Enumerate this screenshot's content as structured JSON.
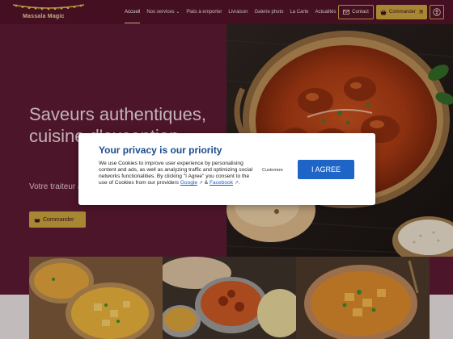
{
  "header": {
    "brand": "Massala Magic",
    "nav": [
      {
        "label": "Accueil",
        "active": true
      },
      {
        "label": "Nos services ⌄",
        "active": false
      },
      {
        "label": "Plats à emporter",
        "active": false
      },
      {
        "label": "Livraison",
        "active": false
      },
      {
        "label": "Galerie photo",
        "active": false
      },
      {
        "label": "La Carte",
        "active": false
      },
      {
        "label": "Actualités",
        "active": false
      }
    ],
    "contact_label": "Contact",
    "order_label": "Commander",
    "accessibility_icon": "accessibility-icon"
  },
  "hero": {
    "title": "Saveurs authentiques, cuisine d'exception",
    "subtitle": "Votre traiteur à Paris",
    "button_label": "Commander"
  },
  "cookie_banner": {
    "title": "Your privacy is our priority",
    "body": "We use Cookies to improve user experience by personalising content and ads, as well as analyzing traffic and optimizing social networks functionalities. By clicking \"I Agree\" you consent to the use of Cookies from our providers",
    "link_google": "Google",
    "link_and": "&",
    "link_facebook": "Facebook",
    "customize_label": "Customize",
    "agree_label": "I AGREE"
  },
  "colors": {
    "brand_bg": "#5a1930",
    "header_bg": "#4e1227",
    "gold": "#c9a43b",
    "banner_title": "#1a4b8c",
    "agree_button": "#1f65c7"
  }
}
